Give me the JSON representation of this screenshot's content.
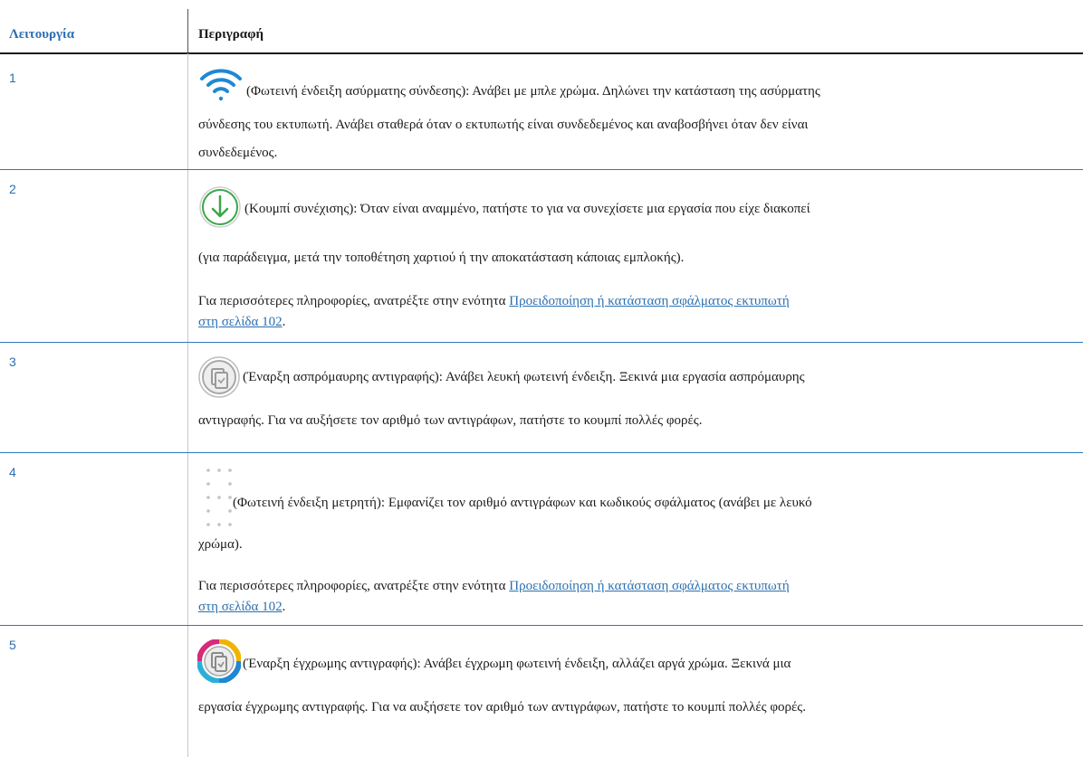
{
  "header": {
    "col1": "Λειτουργία",
    "col2": "Περιγραφή"
  },
  "rows": [
    {
      "num": "1",
      "icon": "wireless-icon",
      "l1": "(Φωτεινή ένδειξη ασύρματης σύνδεσης): Ανάβει με μπλε χρώμα. Δηλώνει την κατάσταση της ασύρματης",
      "l2": "σύνδεσης του εκτυπωτή. Ανάβει σταθερά όταν ο εκτυπωτής είναι συνδεδεμένος και αναβοσβήνει όταν δεν είναι",
      "l3": "συνδεδεμένος."
    },
    {
      "num": "2",
      "icon": "resume-download-icon",
      "l1": "(Κουμπί συνέχισης): Όταν είναι αναμμένο, πατήστε το για να συνεχίσετε μια εργασία που είχε διακοπεί",
      "l2": "(για παράδειγμα, μετά την τοποθέτηση χαρτιού ή την αποκατάσταση κάποιας εμπλοκής).",
      "more_prefix": "Για περισσότερες πληροφορίες, ανατρέξτε στην ενότητα ",
      "link_1": "Προειδοποίηση ή κατάσταση σφάλματος εκτυπωτή",
      "link_2": "στη σελίδα 102",
      "end": "."
    },
    {
      "num": "3",
      "icon": "bw-copy-icon",
      "l1": "(Έναρξη ασπρόμαυρης αντιγραφής): Ανάβει λευκή φωτεινή ένδειξη. Ξεκινά μια εργασία ασπρόμαυρης",
      "l2": "αντιγραφής. Για να αυξήσετε τον αριθμό των αντιγράφων, πατήστε το κουμπί πολλές φορές."
    },
    {
      "num": "4",
      "icon": "counter-display-icon",
      "l1": "(Φωτεινή ένδειξη μετρητή): Εμφανίζει τον αριθμό αντιγράφων και κωδικούς σφάλματος (ανάβει με λευκό",
      "l2": "χρώμα).",
      "more_prefix": "Για περισσότερες πληροφορίες, ανατρέξτε στην ενότητα ",
      "link_1": "Προειδοποίηση ή κατάσταση σφάλματος εκτυπωτή",
      "link_2": "στη σελίδα 102",
      "end": "."
    },
    {
      "num": "5",
      "icon": "color-copy-icon",
      "l1": "(Έναρξη έγχρωμης αντιγραφής): Ανάβει έγχρωμη φωτεινή ένδειξη, αλλάζει αργά χρώμα. Ξεκινά μια",
      "l2": "εργασία έγχρωμης αντιγραφής. Για να αυξήσετε τον αριθμό των αντιγράφων, πατήστε το κουμπί πολλές φορές."
    }
  ],
  "colors": {
    "accent": "#2a6fb0",
    "icon_blue": "#1f88d4",
    "icon_green": "#3aa64a"
  }
}
